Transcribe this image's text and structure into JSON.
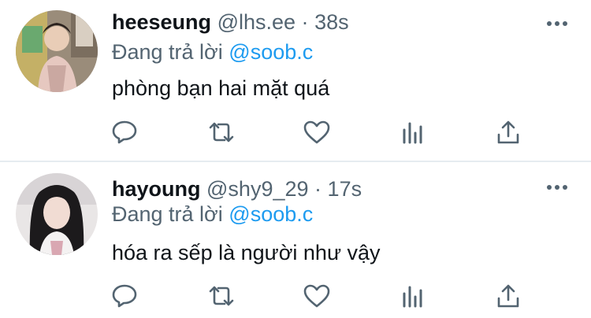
{
  "tweets": [
    {
      "name": "heeseung",
      "handle": "@lhs.ee",
      "separator": "·",
      "time": "38s",
      "reply_prefix": "Đang trả lời",
      "reply_target": "@soob.c",
      "text": "phòng bạn hai mặt quá",
      "avatar_icon": "avatar-photo-icon"
    },
    {
      "name": "hayoung",
      "handle": "@shy9_29",
      "separator": "·",
      "time": "17s",
      "reply_prefix": "Đang trả lời",
      "reply_target": "@soob.c",
      "text": "hóa ra sếp là người như vậy",
      "avatar_icon": "avatar-photo-icon"
    }
  ],
  "actions": [
    "reply-icon",
    "retweet-icon",
    "like-icon",
    "analytics-icon",
    "share-icon"
  ],
  "colors": {
    "link": "#1d9bf0",
    "secondary_text": "#536471",
    "primary_text": "#0f1419",
    "icon": "#536471",
    "divider": "#e6ecf0"
  }
}
